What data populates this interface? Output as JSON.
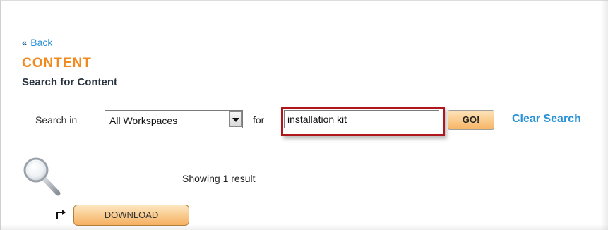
{
  "nav": {
    "back_chevron": "«",
    "back_label": "Back"
  },
  "header": {
    "section_title": "CONTENT",
    "subtitle": "Search for Content"
  },
  "search": {
    "search_in_label": "Search in",
    "workspace_select_value": "All Workspaces",
    "for_label": "for",
    "query_value": "installation kit",
    "go_label": "GO!",
    "clear_label": "Clear Search"
  },
  "results": {
    "count_text": "Showing 1 result",
    "items": [
      {
        "label": "DOWNLOAD"
      }
    ]
  },
  "icons": {
    "magnifier": "magnifier-icon",
    "result_arrow": "return-arrow-icon",
    "dropdown": "chevron-down-icon"
  },
  "colors": {
    "link": "#2a92d6",
    "section_title": "#f2891e",
    "highlight_border": "#b0171c",
    "button_gradient_top": "#fde3b8",
    "button_gradient_bottom": "#f7b566"
  }
}
